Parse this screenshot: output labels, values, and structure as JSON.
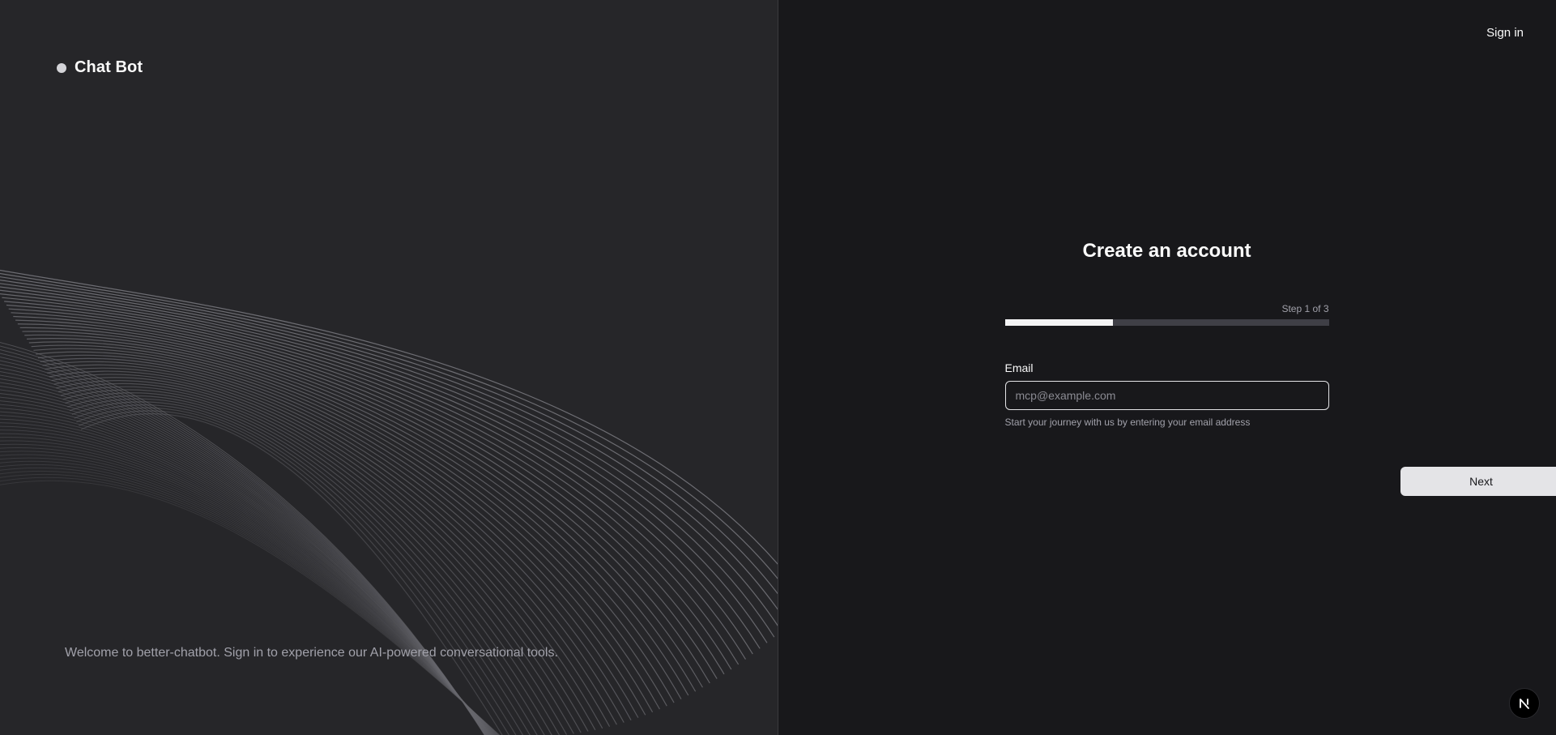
{
  "brand": {
    "name": "Chat Bot"
  },
  "left": {
    "welcome_text": "Welcome to better-chatbot. Sign in to experience our AI-powered conversational tools."
  },
  "header": {
    "signin_label": "Sign in"
  },
  "form": {
    "title": "Create an account",
    "step_text": "Step 1 of 3",
    "progress_fraction": 0.333,
    "email_label": "Email",
    "email_placeholder": "mcp@example.com",
    "email_value": "",
    "hint": "Start your journey with us by entering your email address",
    "next_label": "Next"
  },
  "colors": {
    "left_bg": "#262629",
    "right_bg": "#18181b",
    "progress_fill": "#f4f4f5",
    "progress_track": "#3f3f46",
    "button_bg": "#e4e4e7"
  },
  "icons": {
    "brand": "circle-dot-icon",
    "framework_badge": "nextjs-n-icon"
  }
}
